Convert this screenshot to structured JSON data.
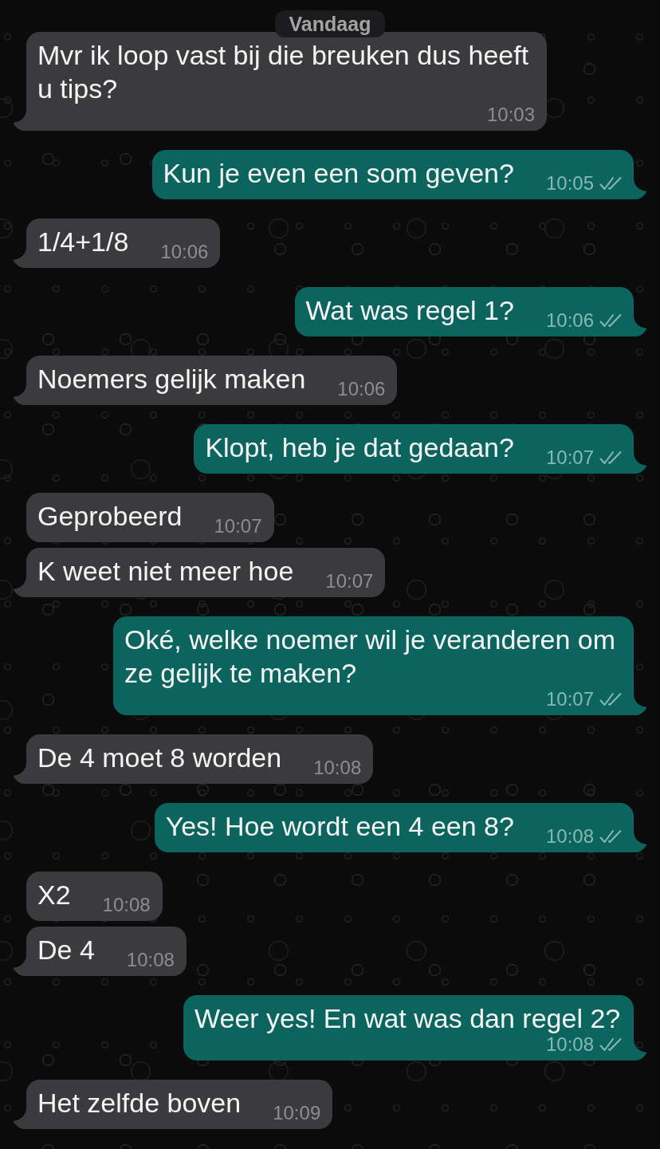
{
  "date_divider": "Vandaag",
  "messages": [
    {
      "kind": "incoming",
      "text": "Mvr ik loop vast bij die breuken dus heeft u tips?",
      "time": "10:03"
    },
    {
      "kind": "outgoing",
      "text": "Kun je even een som geven?",
      "time": "10:05",
      "read": false
    },
    {
      "kind": "incoming",
      "text": "1/4+1/8",
      "time": "10:06"
    },
    {
      "kind": "outgoing",
      "text": "Wat was regel 1?",
      "time": "10:06",
      "read": false
    },
    {
      "kind": "incoming",
      "text": "Noemers gelijk maken",
      "time": "10:06"
    },
    {
      "kind": "outgoing",
      "text": "Klopt, heb je dat gedaan?",
      "time": "10:07",
      "read": false
    },
    {
      "kind": "incoming",
      "text": "Geprobeerd",
      "time": "10:07"
    },
    {
      "kind": "incoming",
      "text": "K weet niet meer hoe",
      "time": "10:07"
    },
    {
      "kind": "outgoing",
      "text": "Oké, welke noemer wil je veranderen om ze gelijk te maken?",
      "time": "10:07",
      "read": false
    },
    {
      "kind": "incoming",
      "text": "De 4 moet 8 worden",
      "time": "10:08"
    },
    {
      "kind": "outgoing",
      "text": "Yes! Hoe wordt een 4 een 8?",
      "time": "10:08",
      "read": false
    },
    {
      "kind": "incoming",
      "text": "X2",
      "time": "10:08"
    },
    {
      "kind": "incoming",
      "text": "De 4",
      "time": "10:08"
    },
    {
      "kind": "outgoing",
      "text": "Weer yes! En wat was dan regel 2?",
      "time": "10:08",
      "read": false
    },
    {
      "kind": "incoming",
      "text": "Het zelfde boven",
      "time": "10:09"
    }
  ]
}
